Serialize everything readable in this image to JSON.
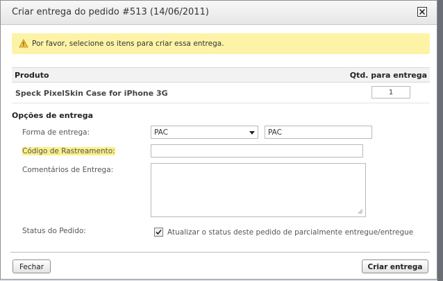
{
  "dialog": {
    "title": "Criar entrega do pedido #513 (14/06/2011)",
    "close_icon": "close-icon"
  },
  "warning": {
    "icon": "warning-icon",
    "text": "Por favor, selecione os itens para criar essa entrega.",
    "background": "#fcf3a6"
  },
  "items_table": {
    "headers": {
      "product": "Produto",
      "quantity": "Qtd. para entrega"
    },
    "rows": [
      {
        "product": "Speck PixelSkin Case for iPhone 3G",
        "quantity": "1"
      }
    ]
  },
  "delivery_options": {
    "section_title": "Opções de entrega",
    "method": {
      "label": "Forma de entrega:",
      "selected": "PAC",
      "text_value": "PAC"
    },
    "tracking": {
      "label": "Código de Rastreamento:",
      "value": "",
      "highlight": "#fbf08a"
    },
    "comments": {
      "label": "Comentários de Entrega:",
      "value": ""
    },
    "order_status": {
      "label": "Status do Pedido:",
      "checked": true,
      "checkbox_label": "Atualizar o status deste pedido de parcialmente entregue/entregue"
    }
  },
  "footer": {
    "close_label": "Fechar",
    "create_label": "Criar entrega"
  }
}
